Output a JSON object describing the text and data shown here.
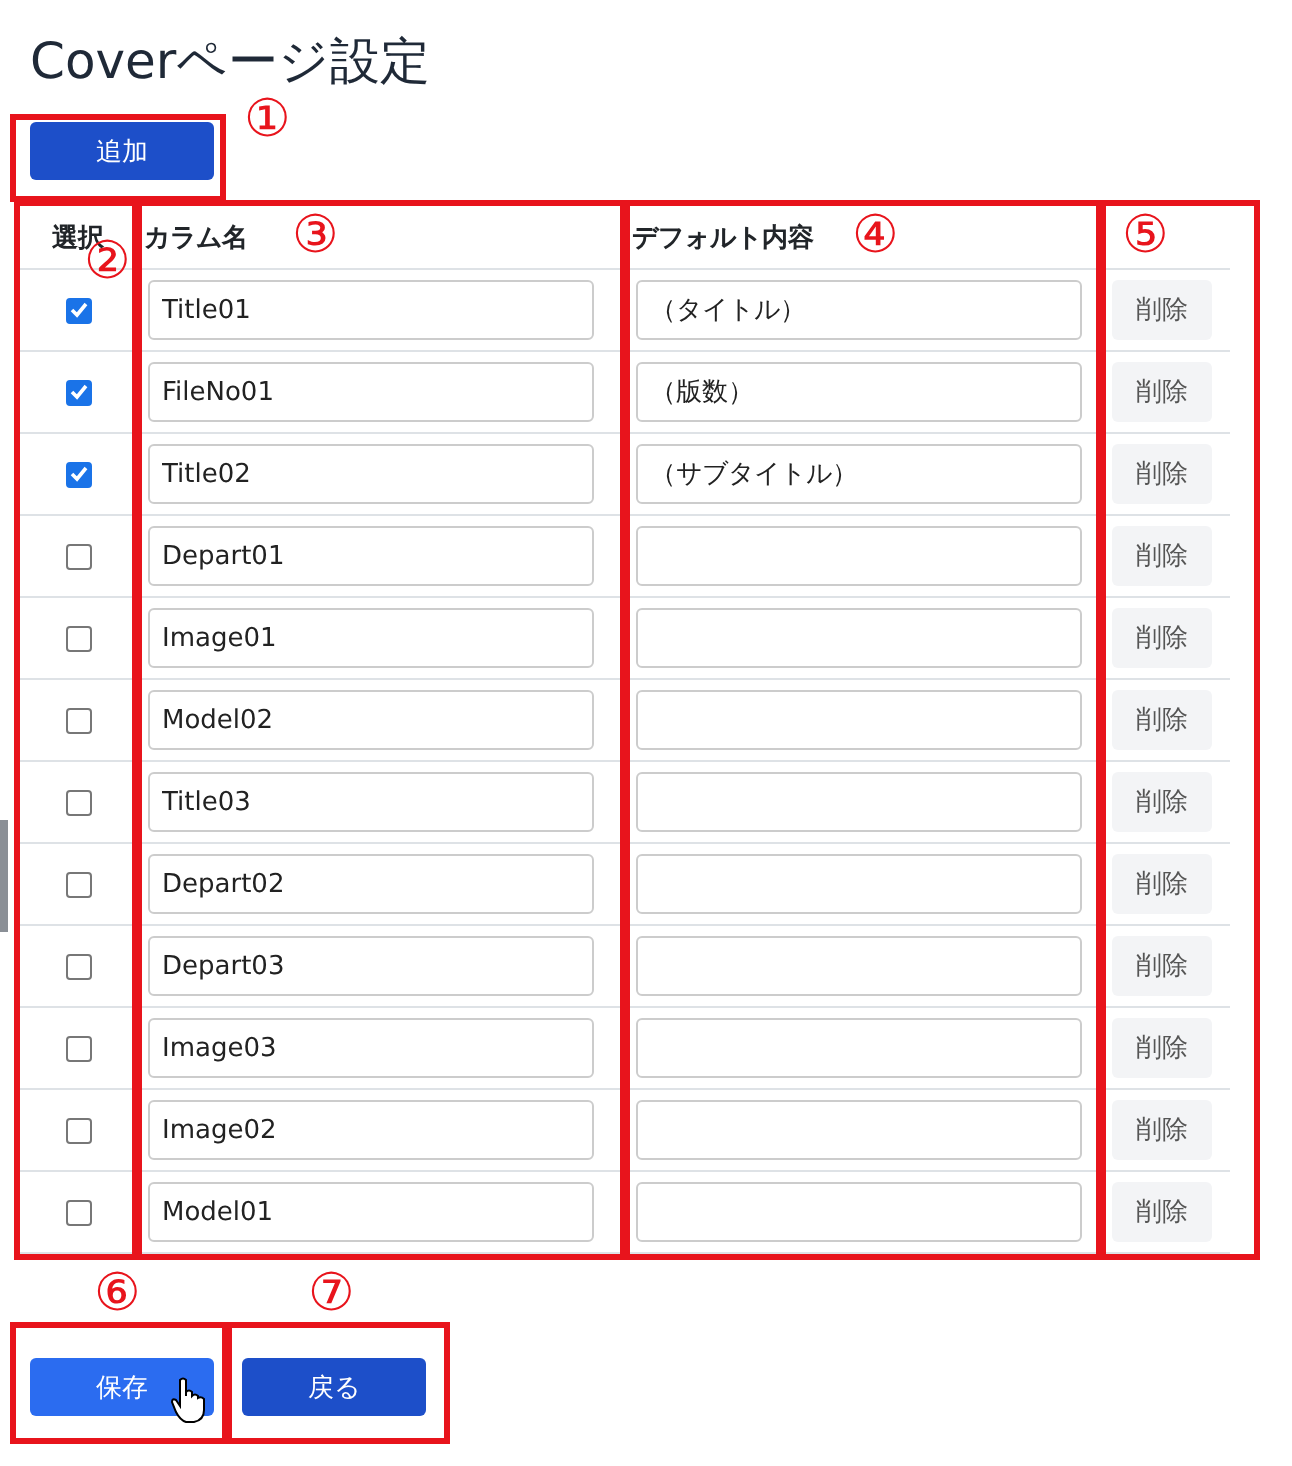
{
  "title": "Coverページ設定",
  "add_button": {
    "label": "追加"
  },
  "table": {
    "columns": [
      {
        "label": "選択"
      },
      {
        "label": "カラム名"
      },
      {
        "label": "デフォルト内容"
      }
    ],
    "rows": [
      {
        "checked": true,
        "name": "Title01",
        "default": "（タイトル）",
        "delete": "削除"
      },
      {
        "checked": true,
        "name": "FileNo01",
        "default": "（版数）",
        "delete": "削除"
      },
      {
        "checked": true,
        "name": "Title02",
        "default": "（サブタイトル）",
        "delete": "削除"
      },
      {
        "checked": false,
        "name": "Depart01",
        "delete": "削除"
      },
      {
        "checked": false,
        "name": "Image01",
        "delete": "削除"
      },
      {
        "checked": false,
        "name": "Model02",
        "delete": "削除"
      },
      {
        "checked": false,
        "name": "Title03",
        "delete": "削除"
      },
      {
        "checked": false,
        "name": "Depart02",
        "delete": "削除"
      },
      {
        "checked": false,
        "name": "Depart03",
        "delete": "削除"
      },
      {
        "checked": false,
        "name": "Image03",
        "delete": "削除"
      },
      {
        "checked": false,
        "name": "Image02",
        "delete": "削除"
      },
      {
        "checked": false,
        "name": "Model01",
        "delete": "削除"
      }
    ]
  },
  "buttons": [
    {
      "label": "保存",
      "hovered": true
    },
    {
      "label": "戻る",
      "hovered": false
    }
  ],
  "callouts": [
    {
      "label": "①",
      "kind": "add"
    },
    {
      "label": "②",
      "kind": "select"
    },
    {
      "label": "③",
      "kind": "name"
    },
    {
      "label": "④",
      "kind": "default"
    },
    {
      "label": "⑤",
      "kind": "delete"
    },
    {
      "label": "⑥",
      "kind": "save"
    },
    {
      "label": "⑦",
      "kind": "back"
    }
  ]
}
